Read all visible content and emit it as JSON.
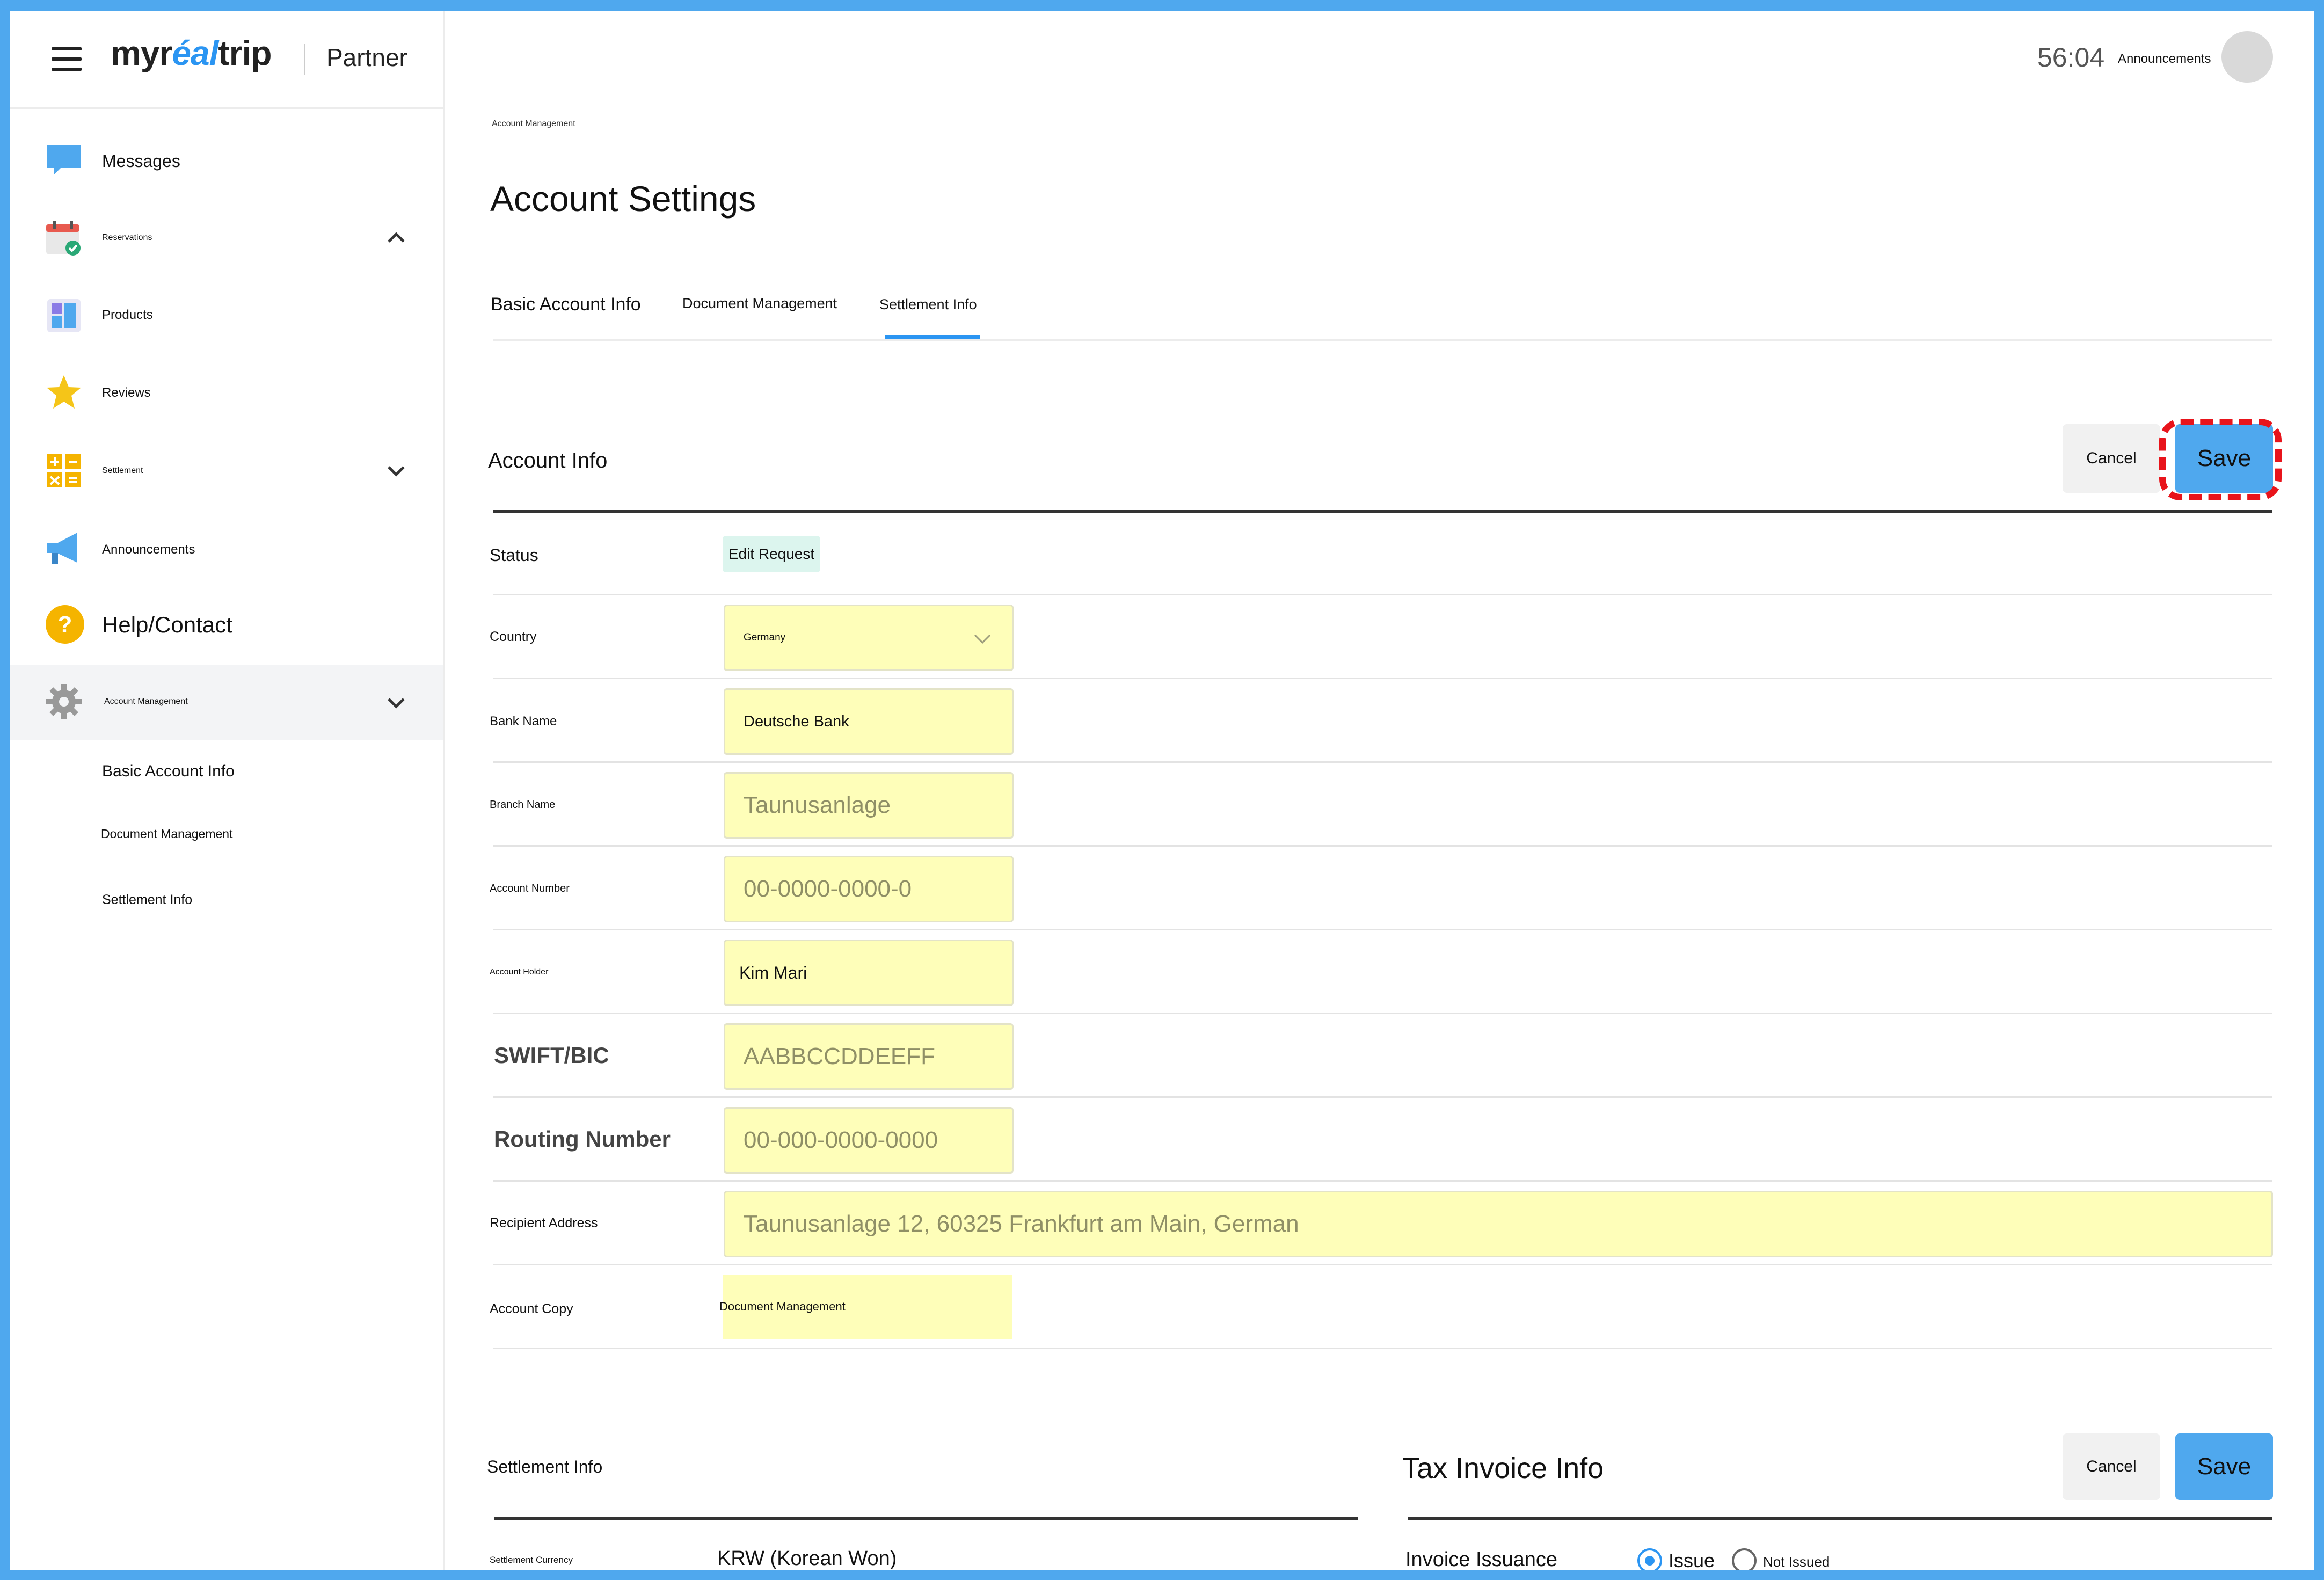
{
  "brand": {
    "logo_pre": "myr",
    "logo_accent": "éal",
    "logo_post": "trip",
    "partner": "Partner"
  },
  "header": {
    "timer": "56:04",
    "announcements": "Announcements"
  },
  "sidebar": {
    "items": [
      {
        "label": "Messages",
        "icon": "chat-bubble-icon"
      },
      {
        "label": "Reservations",
        "icon": "calendar-check-icon"
      },
      {
        "label": "Products",
        "icon": "dashboard-icon"
      },
      {
        "label": "Reviews",
        "icon": "star-icon"
      },
      {
        "label": "Settlement",
        "icon": "calculator-icon"
      },
      {
        "label": "Announcements",
        "icon": "megaphone-icon"
      },
      {
        "label": "Help/Contact",
        "icon": "help-circle-icon"
      },
      {
        "label": "Account Management",
        "icon": "gear-icon"
      }
    ],
    "sub_items": [
      "Basic Account Info",
      "Document Management",
      "Settlement Info"
    ]
  },
  "main": {
    "breadcrumb": "Account Management",
    "title": "Account Settings",
    "tabs": [
      "Basic Account Info",
      "Document Management",
      "Settlement Info"
    ],
    "account_info": {
      "title": "Account Info",
      "cancel": "Cancel",
      "save": "Save",
      "fields": [
        {
          "label": "Status",
          "value": "Edit Request"
        },
        {
          "label": "Country",
          "value": "Germany"
        },
        {
          "label": "Bank Name",
          "value": "Deutsche Bank"
        },
        {
          "label": "Branch Name",
          "placeholder": "Taunusanlage"
        },
        {
          "label": "Account Number",
          "placeholder": "00-0000-0000-0"
        },
        {
          "label": "Account Holder",
          "value": "Kim Mari"
        },
        {
          "label": "SWIFT/BIC",
          "placeholder": "AABBCCDDEEFF"
        },
        {
          "label": "Routing Number",
          "placeholder": "00-000-0000-0000"
        },
        {
          "label": "Recipient Address",
          "placeholder": "Taunusanlage 12, 60325 Frankfurt am Main, German"
        },
        {
          "label": "Account Copy",
          "value": "Document Management"
        }
      ]
    },
    "settlement_info": {
      "title": "Settlement Info",
      "currency_label": "Settlement Currency",
      "currency_value": "KRW (Korean Won)"
    },
    "tax_invoice": {
      "title": "Tax Invoice Info",
      "cancel": "Cancel",
      "save": "Save",
      "issuance_label": "Invoice Issuance",
      "options": [
        "Issue",
        "Not Issued"
      ],
      "selected": "Issue"
    }
  },
  "colors": {
    "accent": "#2b95f2",
    "field_bg": "#fefeb9",
    "highlight": "#e8141b",
    "frame": "#4fa8ee"
  }
}
